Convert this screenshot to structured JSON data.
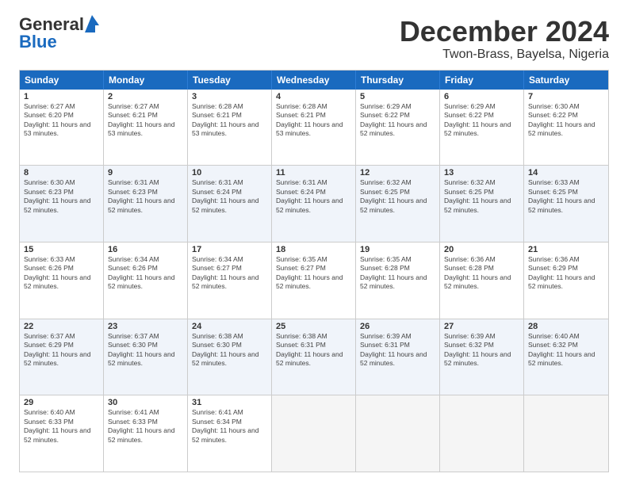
{
  "logo": {
    "line1": "General",
    "line2": "Blue"
  },
  "header": {
    "month": "December 2024",
    "location": "Twon-Brass, Bayelsa, Nigeria"
  },
  "weekdays": [
    "Sunday",
    "Monday",
    "Tuesday",
    "Wednesday",
    "Thursday",
    "Friday",
    "Saturday"
  ],
  "rows": [
    [
      {
        "date": "1",
        "sunrise": "6:27 AM",
        "sunset": "6:20 PM",
        "daylight": "11 hours and 53 minutes."
      },
      {
        "date": "2",
        "sunrise": "6:27 AM",
        "sunset": "6:21 PM",
        "daylight": "11 hours and 53 minutes."
      },
      {
        "date": "3",
        "sunrise": "6:28 AM",
        "sunset": "6:21 PM",
        "daylight": "11 hours and 53 minutes."
      },
      {
        "date": "4",
        "sunrise": "6:28 AM",
        "sunset": "6:21 PM",
        "daylight": "11 hours and 53 minutes."
      },
      {
        "date": "5",
        "sunrise": "6:29 AM",
        "sunset": "6:22 PM",
        "daylight": "11 hours and 52 minutes."
      },
      {
        "date": "6",
        "sunrise": "6:29 AM",
        "sunset": "6:22 PM",
        "daylight": "11 hours and 52 minutes."
      },
      {
        "date": "7",
        "sunrise": "6:30 AM",
        "sunset": "6:22 PM",
        "daylight": "11 hours and 52 minutes."
      }
    ],
    [
      {
        "date": "8",
        "sunrise": "6:30 AM",
        "sunset": "6:23 PM",
        "daylight": "11 hours and 52 minutes."
      },
      {
        "date": "9",
        "sunrise": "6:31 AM",
        "sunset": "6:23 PM",
        "daylight": "11 hours and 52 minutes."
      },
      {
        "date": "10",
        "sunrise": "6:31 AM",
        "sunset": "6:24 PM",
        "daylight": "11 hours and 52 minutes."
      },
      {
        "date": "11",
        "sunrise": "6:31 AM",
        "sunset": "6:24 PM",
        "daylight": "11 hours and 52 minutes."
      },
      {
        "date": "12",
        "sunrise": "6:32 AM",
        "sunset": "6:25 PM",
        "daylight": "11 hours and 52 minutes."
      },
      {
        "date": "13",
        "sunrise": "6:32 AM",
        "sunset": "6:25 PM",
        "daylight": "11 hours and 52 minutes."
      },
      {
        "date": "14",
        "sunrise": "6:33 AM",
        "sunset": "6:25 PM",
        "daylight": "11 hours and 52 minutes."
      }
    ],
    [
      {
        "date": "15",
        "sunrise": "6:33 AM",
        "sunset": "6:26 PM",
        "daylight": "11 hours and 52 minutes."
      },
      {
        "date": "16",
        "sunrise": "6:34 AM",
        "sunset": "6:26 PM",
        "daylight": "11 hours and 52 minutes."
      },
      {
        "date": "17",
        "sunrise": "6:34 AM",
        "sunset": "6:27 PM",
        "daylight": "11 hours and 52 minutes."
      },
      {
        "date": "18",
        "sunrise": "6:35 AM",
        "sunset": "6:27 PM",
        "daylight": "11 hours and 52 minutes."
      },
      {
        "date": "19",
        "sunrise": "6:35 AM",
        "sunset": "6:28 PM",
        "daylight": "11 hours and 52 minutes."
      },
      {
        "date": "20",
        "sunrise": "6:36 AM",
        "sunset": "6:28 PM",
        "daylight": "11 hours and 52 minutes."
      },
      {
        "date": "21",
        "sunrise": "6:36 AM",
        "sunset": "6:29 PM",
        "daylight": "11 hours and 52 minutes."
      }
    ],
    [
      {
        "date": "22",
        "sunrise": "6:37 AM",
        "sunset": "6:29 PM",
        "daylight": "11 hours and 52 minutes."
      },
      {
        "date": "23",
        "sunrise": "6:37 AM",
        "sunset": "6:30 PM",
        "daylight": "11 hours and 52 minutes."
      },
      {
        "date": "24",
        "sunrise": "6:38 AM",
        "sunset": "6:30 PM",
        "daylight": "11 hours and 52 minutes."
      },
      {
        "date": "25",
        "sunrise": "6:38 AM",
        "sunset": "6:31 PM",
        "daylight": "11 hours and 52 minutes."
      },
      {
        "date": "26",
        "sunrise": "6:39 AM",
        "sunset": "6:31 PM",
        "daylight": "11 hours and 52 minutes."
      },
      {
        "date": "27",
        "sunrise": "6:39 AM",
        "sunset": "6:32 PM",
        "daylight": "11 hours and 52 minutes."
      },
      {
        "date": "28",
        "sunrise": "6:40 AM",
        "sunset": "6:32 PM",
        "daylight": "11 hours and 52 minutes."
      }
    ],
    [
      {
        "date": "29",
        "sunrise": "6:40 AM",
        "sunset": "6:33 PM",
        "daylight": "11 hours and 52 minutes."
      },
      {
        "date": "30",
        "sunrise": "6:41 AM",
        "sunset": "6:33 PM",
        "daylight": "11 hours and 52 minutes."
      },
      {
        "date": "31",
        "sunrise": "6:41 AM",
        "sunset": "6:34 PM",
        "daylight": "11 hours and 52 minutes."
      },
      null,
      null,
      null,
      null
    ]
  ],
  "row_alt": [
    false,
    true,
    false,
    true,
    false
  ]
}
